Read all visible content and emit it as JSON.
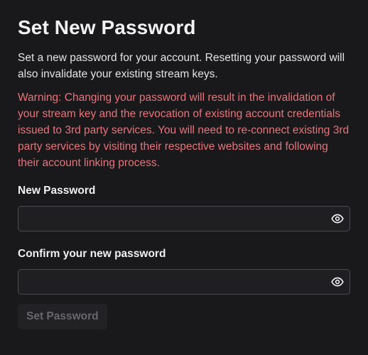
{
  "dialog": {
    "title": "Set New Password",
    "description": "Set a new password for your account. Resetting your password will also invalidate your existing stream keys.",
    "warning": "Warning: Changing your password will result in the invalidation of your stream key and the revocation of existing account credentials issued to 3rd party services. You will need to re-connect existing 3rd party services by visiting their respective websites and following their account linking process."
  },
  "new_password": {
    "label": "New Password",
    "value": "",
    "toggle_icon": "eye-icon"
  },
  "confirm_password": {
    "label": "Confirm your new password",
    "value": "",
    "toggle_icon": "eye-icon"
  },
  "submit": {
    "label": "Set Password",
    "disabled": true
  },
  "colors": {
    "background": "#19191b",
    "text": "#f2f2f3",
    "warning": "#e8737a",
    "input_border": "#4a4a4f",
    "button_bg": "#222225",
    "button_text_disabled": "#67676c"
  }
}
